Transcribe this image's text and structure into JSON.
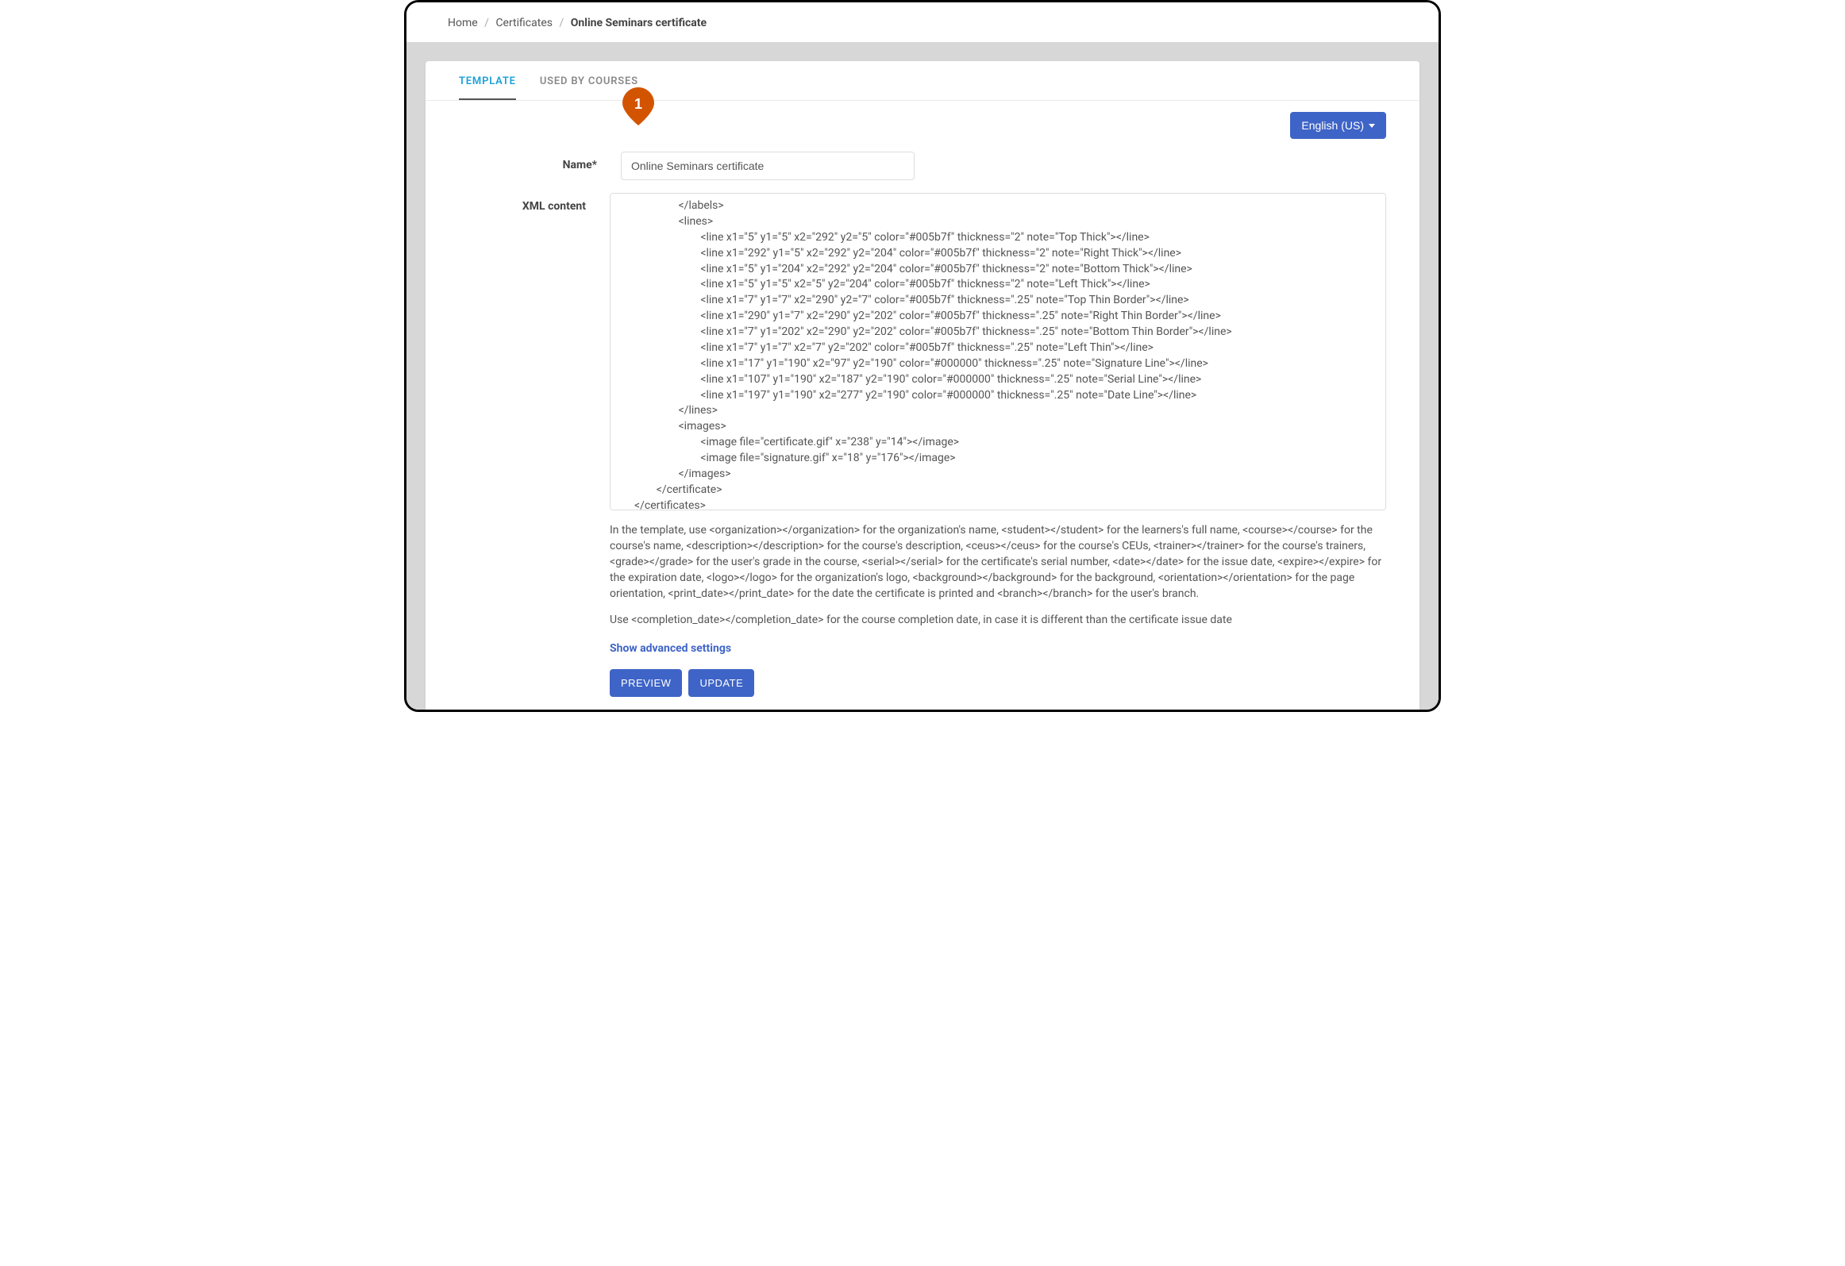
{
  "breadcrumb": {
    "home": "Home",
    "certificates": "Certificates",
    "current": "Online Seminars certificate"
  },
  "tabs": {
    "template": "TEMPLATE",
    "used_by": "USED BY COURSES"
  },
  "language": {
    "label": "English (US)"
  },
  "form": {
    "name_label": "Name*",
    "name_value": "Online Seminars certificate",
    "xml_label": "XML content",
    "xml_value": "                </labels>\n                <lines>\n                        <line x1=\"5\" y1=\"5\" x2=\"292\" y2=\"5\" color=\"#005b7f\" thickness=\"2\" note=\"Top Thick\"></line>\n                        <line x1=\"292\" y1=\"5\" x2=\"292\" y2=\"204\" color=\"#005b7f\" thickness=\"2\" note=\"Right Thick\"></line>\n                        <line x1=\"5\" y1=\"204\" x2=\"292\" y2=\"204\" color=\"#005b7f\" thickness=\"2\" note=\"Bottom Thick\"></line>\n                        <line x1=\"5\" y1=\"5\" x2=\"5\" y2=\"204\" color=\"#005b7f\" thickness=\"2\" note=\"Left Thick\"></line>\n                        <line x1=\"7\" y1=\"7\" x2=\"290\" y2=\"7\" color=\"#005b7f\" thickness=\".25\" note=\"Top Thin Border\"></line>\n                        <line x1=\"290\" y1=\"7\" x2=\"290\" y2=\"202\" color=\"#005b7f\" thickness=\".25\" note=\"Right Thin Border\"></line>\n                        <line x1=\"7\" y1=\"202\" x2=\"290\" y2=\"202\" color=\"#005b7f\" thickness=\".25\" note=\"Bottom Thin Border\"></line>\n                        <line x1=\"7\" y1=\"7\" x2=\"7\" y2=\"202\" color=\"#005b7f\" thickness=\".25\" note=\"Left Thin\"></line>\n                        <line x1=\"17\" y1=\"190\" x2=\"97\" y2=\"190\" color=\"#000000\" thickness=\".25\" note=\"Signature Line\"></line>\n                        <line x1=\"107\" y1=\"190\" x2=\"187\" y2=\"190\" color=\"#000000\" thickness=\".25\" note=\"Serial Line\"></line>\n                        <line x1=\"197\" y1=\"190\" x2=\"277\" y2=\"190\" color=\"#000000\" thickness=\".25\" note=\"Date Line\"></line>\n                </lines>\n                <images>\n                        <image file=\"certificate.gif\" x=\"238\" y=\"14\"></image>\n                        <image file=\"signature.gif\" x=\"18\" y=\"176\"></image>\n                </images>\n        </certificate>\n</certificates>"
  },
  "help": {
    "p1": "In the template, use <organization></organization> for the organization's name, <student></student> for the learners's full name, <course></course> for the course's name, <description></description> for the course's description, <ceus></ceus> for the course's CEUs, <trainer></trainer> for the course's trainers, <grade></grade> for the user's grade in the course, <serial></serial> for the certificate's serial number, <date></date> for the issue date, <expire></expire> for the expiration date, <logo></logo> for the organization's logo, <background></background> for the background, <orientation></orientation> for the page orientation, <print_date></print_date> for the date the certificate is printed and <branch></branch> for the user's branch.",
    "p2": "Use <completion_date></completion_date> for the course completion date, in case it is different than the certificate issue date",
    "advanced": "Show advanced settings"
  },
  "buttons": {
    "preview": "PREVIEW",
    "update": "UPDATE"
  },
  "annotation": {
    "pin1": "1"
  }
}
